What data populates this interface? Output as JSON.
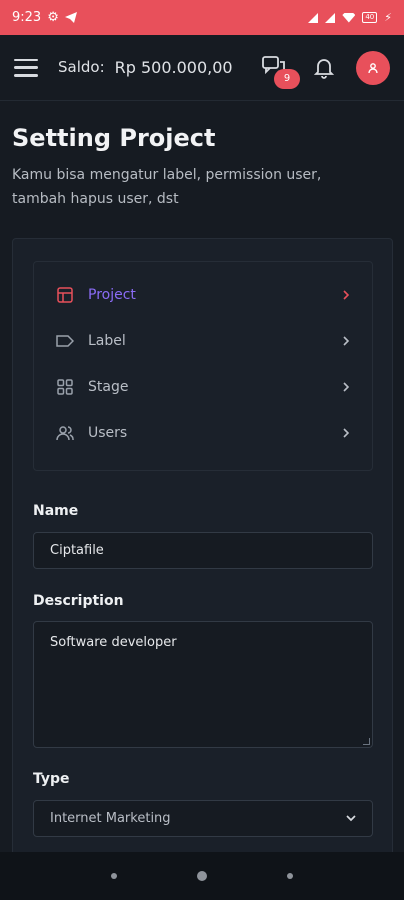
{
  "status_bar": {
    "time": "9:23",
    "battery": "40"
  },
  "header": {
    "saldo_label": "Saldo:",
    "saldo_value": "Rp 500.000,00",
    "chat_badge": "9"
  },
  "page": {
    "title": "Setting Project",
    "subtitle": "Kamu bisa mengatur label, permission user, tambah hapus user, dst"
  },
  "menu": {
    "items": [
      {
        "label": "Project",
        "icon": "layout-icon",
        "active": true
      },
      {
        "label": "Label",
        "icon": "tag-icon",
        "active": false
      },
      {
        "label": "Stage",
        "icon": "grid-icon",
        "active": false
      },
      {
        "label": "Users",
        "icon": "users-icon",
        "active": false
      }
    ]
  },
  "form": {
    "name_label": "Name",
    "name_value": "Ciptafile",
    "description_label": "Description",
    "description_value": "Software developer",
    "type_label": "Type",
    "type_value": "Internet Marketing"
  },
  "colors": {
    "accent": "#e8505b",
    "active_text": "#8b6cf6",
    "background": "#161b22"
  }
}
